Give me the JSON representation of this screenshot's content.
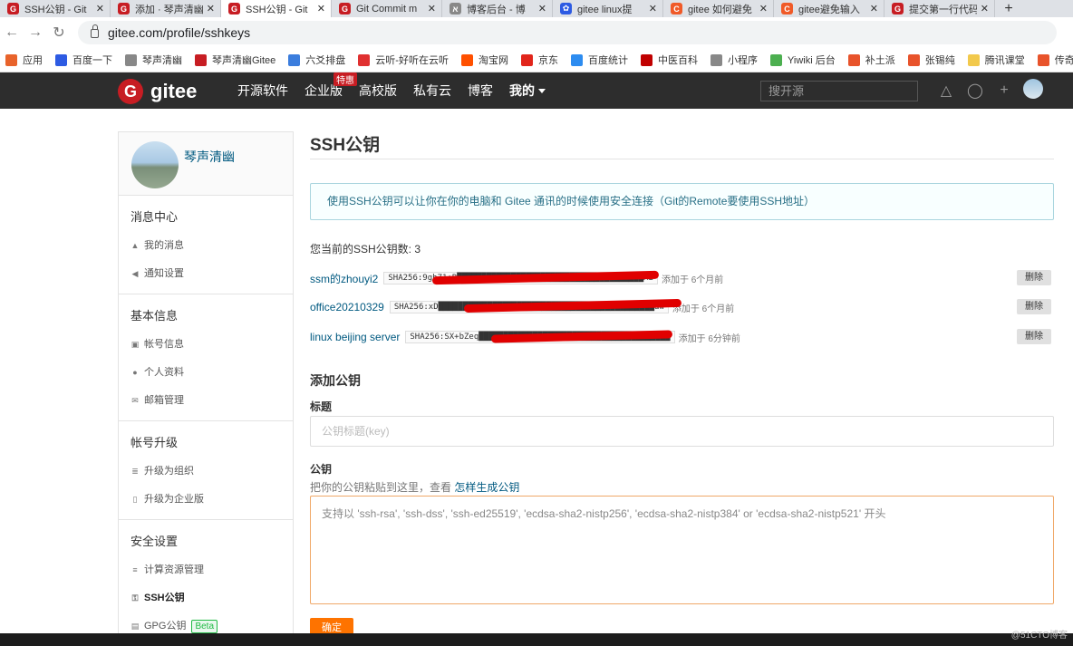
{
  "browser": {
    "tabs": [
      {
        "title": "SSH公钥 - Git",
        "color": "#c71d23",
        "glyph": "G"
      },
      {
        "title": "添加 · 琴声清幽",
        "color": "#c71d23",
        "glyph": "G"
      },
      {
        "title": "SSH公钥 - Git",
        "color": "#c71d23",
        "glyph": "G",
        "active": true
      },
      {
        "title": "Git Commit m",
        "color": "#c71d23",
        "glyph": "G"
      },
      {
        "title": "博客后台 - 博",
        "color": "#888888",
        "glyph": "א"
      },
      {
        "title": "gitee linux提",
        "color": "#2d5be3",
        "glyph": "✿"
      },
      {
        "title": "gitee 如何避免",
        "color": "#f05a28",
        "glyph": "C"
      },
      {
        "title": "gitee避免输入",
        "color": "#f05a28",
        "glyph": "C"
      },
      {
        "title": "提交第一行代码",
        "color": "#c71d23",
        "glyph": "G"
      }
    ],
    "url": "gitee.com/profile/sshkeys",
    "bookmarks": [
      {
        "label": "应用",
        "color": "#e8632b"
      },
      {
        "label": "百度一下",
        "color": "#2d5be3"
      },
      {
        "label": "琴声清幽",
        "color": "#888888"
      },
      {
        "label": "琴声清幽Gitee",
        "color": "#c71d23"
      },
      {
        "label": "六爻排盘",
        "color": "#3b7ddd"
      },
      {
        "label": "云听-好听在云听",
        "color": "#e03030"
      },
      {
        "label": "淘宝网",
        "color": "#ff5000"
      },
      {
        "label": "京东",
        "color": "#e1251b"
      },
      {
        "label": "百度统计",
        "color": "#2d8cf0"
      },
      {
        "label": "中医百科",
        "color": "#c00000"
      },
      {
        "label": "小程序",
        "color": "#888888"
      },
      {
        "label": "Yiwiki 后台",
        "color": "#4caf50"
      },
      {
        "label": "补土派",
        "color": "#e8532b"
      },
      {
        "label": "张锡纯",
        "color": "#e8532b"
      },
      {
        "label": "腾讯课堂",
        "color": "#f2c94c"
      },
      {
        "label": "传奇大",
        "color": "#e8532b"
      }
    ]
  },
  "header": {
    "brand": "gitee",
    "nav": [
      "开源软件",
      "企业版",
      "高校版",
      "私有云",
      "博客",
      "我的"
    ],
    "badge": "特惠",
    "search_placeholder": "搜开源"
  },
  "sidebar": {
    "username": "琴声清幽",
    "sections": [
      {
        "title": "消息中心",
        "items": [
          {
            "icon": "bell-icon",
            "glyph": "▲",
            "label": "我的消息"
          },
          {
            "icon": "speaker-icon",
            "glyph": "◀",
            "label": "通知设置"
          }
        ]
      },
      {
        "title": "基本信息",
        "items": [
          {
            "icon": "id-card-icon",
            "glyph": "▣",
            "label": "帐号信息"
          },
          {
            "icon": "user-icon",
            "glyph": "●",
            "label": "个人资料"
          },
          {
            "icon": "mail-icon",
            "glyph": "✉",
            "label": "邮箱管理"
          }
        ]
      },
      {
        "title": "帐号升级",
        "items": [
          {
            "icon": "users-icon",
            "glyph": "≣",
            "label": "升级为组织"
          },
          {
            "icon": "building-icon",
            "glyph": "▯",
            "label": "升级为企业版"
          }
        ]
      },
      {
        "title": "安全设置",
        "items": [
          {
            "icon": "list-icon",
            "glyph": "≡",
            "label": "计算资源管理"
          },
          {
            "icon": "key-icon",
            "glyph": "⚿",
            "label": "SSH公钥",
            "active": true
          },
          {
            "icon": "lock-icon",
            "glyph": "▤",
            "label": "GPG公钥",
            "badge": "Beta"
          }
        ]
      }
    ]
  },
  "main": {
    "title": "SSH公钥",
    "info": "使用SSH公钥可以让你在你的电脑和 Gitee 通讯的时候使用安全连接（Git的Remote要使用SSH地址）",
    "count_text": "您当前的SSH公钥数: 3",
    "keys": [
      {
        "name": "ssm的zhouyi2",
        "fingerprint": "SHA256:9ghZ1+B██████████████████████████████████████ME",
        "added": "添加于 6个月前",
        "delete": "删除"
      },
      {
        "name": "office20210329",
        "fingerprint": "SHA256:xD████████████████████████████████████████████aw",
        "added": "添加于 6个月前",
        "delete": "删除"
      },
      {
        "name": "linux beijing server",
        "fingerprint": "SHA256:SX+bZeq███████████████████████████████████████",
        "added": "添加于 6分钟前",
        "delete": "删除"
      }
    ],
    "add_heading": "添加公钥",
    "title_label": "标题",
    "title_placeholder": "公钥标题(key)",
    "key_label": "公钥",
    "hint_prefix": "把你的公钥粘贴到这里，查看",
    "hint_link": "怎样生成公钥",
    "key_placeholder": "支持以 'ssh-rsa', 'ssh-dss', 'ssh-ed25519', 'ecdsa-sha2-nistp256', 'ecdsa-sha2-nistp384' or 'ecdsa-sha2-nistp521' 开头",
    "confirm": "确定"
  },
  "watermark": "@51CTO博客"
}
